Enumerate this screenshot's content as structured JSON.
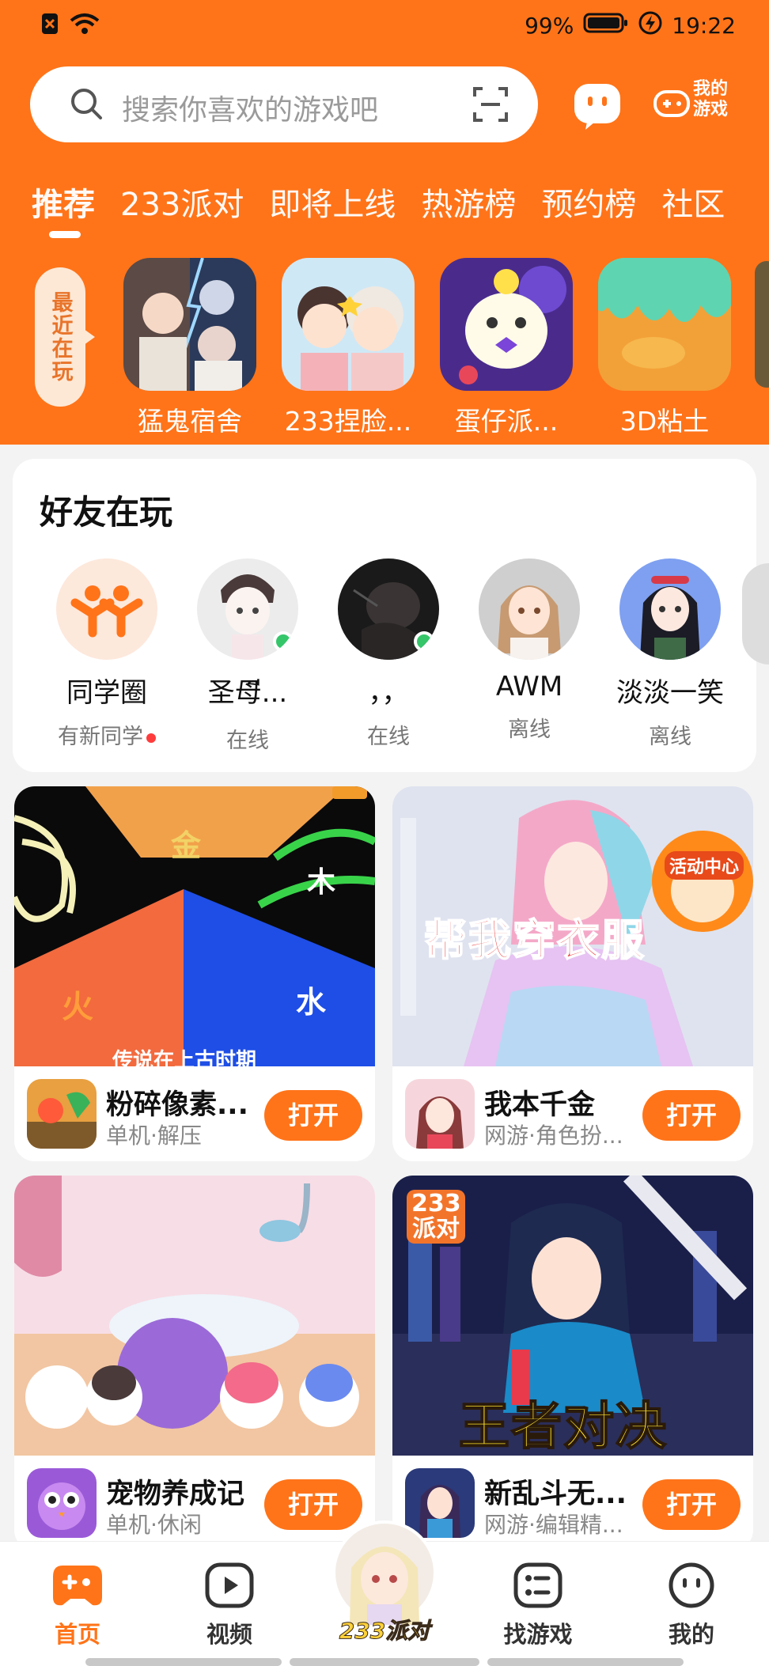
{
  "statusbar": {
    "battery": "99%",
    "time": "19:22"
  },
  "search": {
    "placeholder": "搜索你喜欢的游戏吧"
  },
  "header": {
    "my_games_label": "我的游戏"
  },
  "tabs": [
    {
      "label": "推荐",
      "active": true
    },
    {
      "label": "233派对"
    },
    {
      "label": "即将上线"
    },
    {
      "label": "热游榜"
    },
    {
      "label": "预约榜"
    },
    {
      "label": "社区"
    }
  ],
  "recent": {
    "label": "最近在玩",
    "games": [
      {
        "name": "猛鬼宿舍"
      },
      {
        "name": "233捏脸..."
      },
      {
        "name": "蛋仔派..."
      },
      {
        "name": "3D粘土"
      }
    ]
  },
  "friends": {
    "title": "好友在玩",
    "items": [
      {
        "name": "同学圈",
        "status": "有新同学",
        "online": false
      },
      {
        "name": "圣母ี...",
        "status": "在线",
        "online": true
      },
      {
        "name": "，，",
        "status": "在线",
        "online": true
      },
      {
        "name": "AWM",
        "status": "离线",
        "online": false
      },
      {
        "name": "淡淡一笑",
        "status": "离线",
        "online": false
      }
    ]
  },
  "games": [
    {
      "name": "粉碎像素...",
      "tags": "单机·解压",
      "open_label": "打开",
      "overlay": [
        "金",
        "木",
        "火",
        "水",
        "传说在上古时期"
      ]
    },
    {
      "name": "我本千金",
      "tags": "网游·角色扮...",
      "open_label": "打开",
      "overlay": [
        "帮我穿衣服",
        "活动中心"
      ]
    },
    {
      "name": "宠物养成记",
      "tags": "单机·休闲",
      "open_label": "打开"
    },
    {
      "name": "新乱斗无...",
      "tags": "网游·编辑精...",
      "open_label": "打开",
      "overlay": [
        "233派对",
        "王者对决"
      ]
    }
  ],
  "bottom_nav": [
    {
      "label": "首页",
      "icon": "gamepad-icon",
      "active": true
    },
    {
      "label": "视频",
      "icon": "play-icon"
    },
    {
      "label": "233派对",
      "icon": "party-avatar"
    },
    {
      "label": "找游戏",
      "icon": "list-icon"
    },
    {
      "label": "我的",
      "icon": "face-icon"
    }
  ],
  "colors": {
    "accent": "#ff7419",
    "online": "#35c66a"
  }
}
